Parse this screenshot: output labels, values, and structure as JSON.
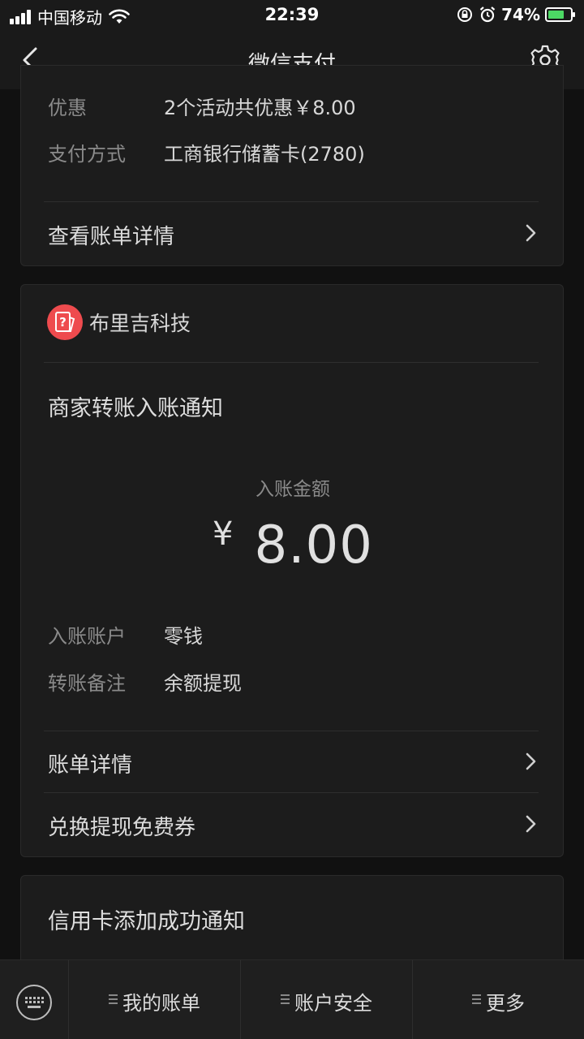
{
  "status_bar": {
    "carrier": "中国移动",
    "time": "22:39",
    "battery": "74%",
    "battery_level": 0.74,
    "icons": [
      "signal-icon",
      "wifi-icon",
      "orientation-lock-icon",
      "alarm-icon",
      "battery-icon"
    ]
  },
  "nav": {
    "title": "微信支付",
    "back_icon": "chevron-left-icon",
    "settings_icon": "gear-icon"
  },
  "card_previous": {
    "rows": [
      {
        "label": "优惠",
        "value": "2个活动共优惠￥8.00"
      },
      {
        "label": "支付方式",
        "value": "工商银行储蓄卡(2780)"
      }
    ],
    "link": "查看账单详情"
  },
  "card_transfer": {
    "merchant_name": "布里吉科技",
    "merchant_logo_color": "#ee4b4e",
    "title": "商家转账入账通知",
    "amount_label": "入账金额",
    "currency": "¥",
    "amount": "8.00",
    "rows": [
      {
        "label": "入账账户",
        "value": "零钱"
      },
      {
        "label": "转账备注",
        "value": "余额提现"
      }
    ],
    "links": [
      "账单详情",
      "兑换提现免费券"
    ]
  },
  "card_next": {
    "title": "信用卡添加成功通知"
  },
  "bottom_menu": {
    "keyboard_icon": "keyboard-icon",
    "items": [
      "我的账单",
      "账户安全",
      "更多"
    ]
  },
  "colors": {
    "background": "#111111",
    "card": "#1c1c1c",
    "battery_fill": "#4cd964"
  }
}
